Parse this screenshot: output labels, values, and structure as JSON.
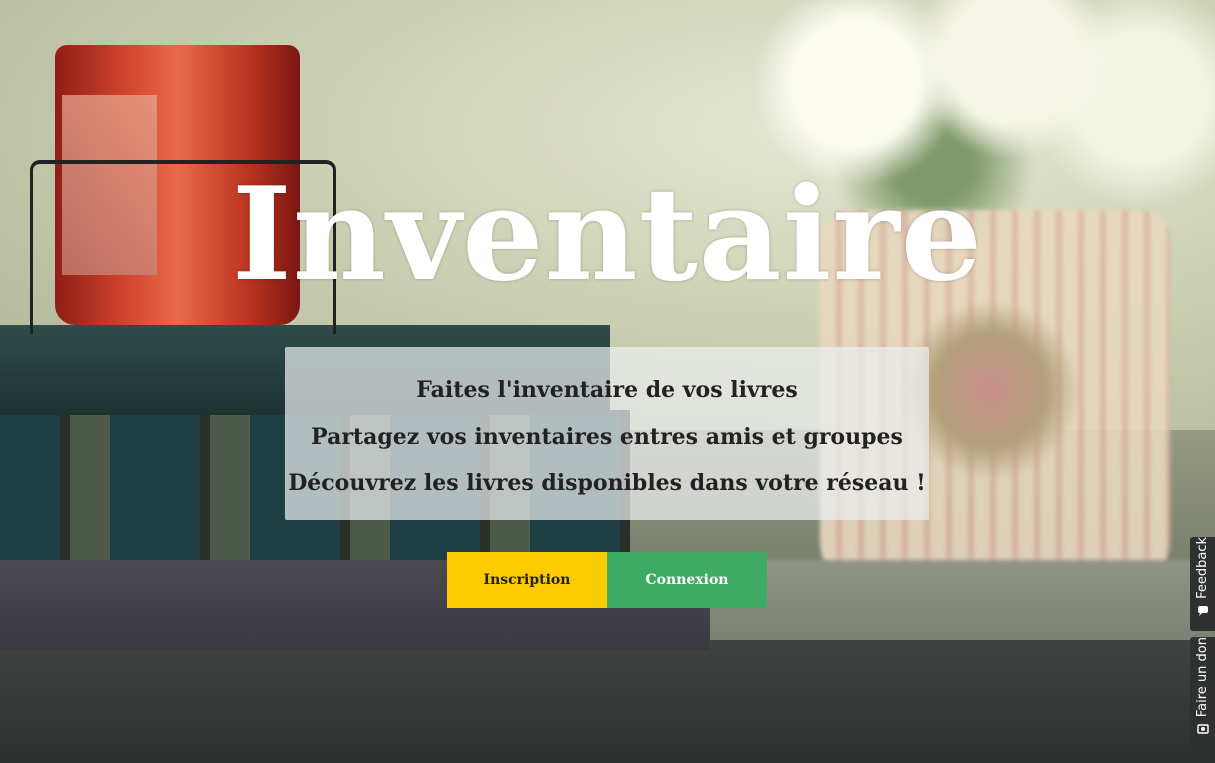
{
  "hero": {
    "title": "Inventaire",
    "taglines": [
      "Faites l'inventaire de vos livres",
      "Partagez vos inventaires entres amis et groupes",
      "Découvrez les livres disponibles dans votre réseau !"
    ]
  },
  "actions": {
    "signup_label": "Inscription",
    "login_label": "Connexion"
  },
  "side_tabs": {
    "feedback_label": "Feedback",
    "feedback_icon": "chat-bubble-icon",
    "donate_label": "Faire un don",
    "donate_icon": "money-icon"
  },
  "colors": {
    "signup_button": "#fecb01",
    "login_button": "#3eaa64",
    "side_tab": "#2f3131",
    "title": "#ffffff"
  }
}
